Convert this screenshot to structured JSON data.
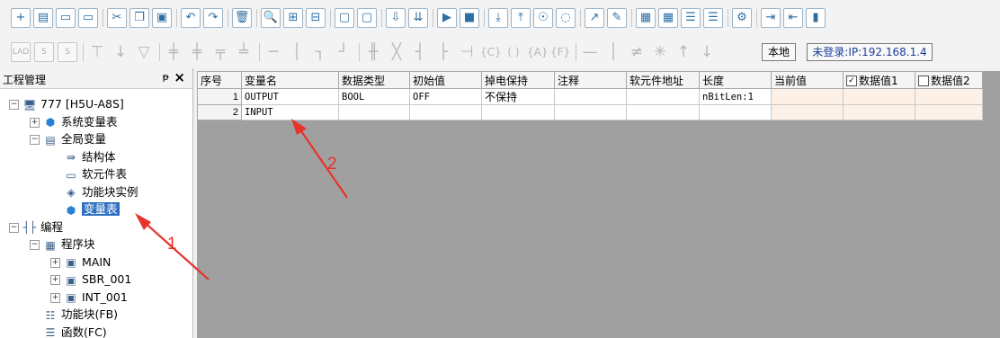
{
  "toolbar_row1": [
    {
      "name": "new-file",
      "glyph": "+"
    },
    {
      "name": "open-folder",
      "glyph": "▤"
    },
    {
      "name": "save",
      "glyph": "▭"
    },
    {
      "name": "save-all",
      "glyph": "▭"
    },
    {
      "name": "cut",
      "glyph": "✂"
    },
    {
      "name": "copy",
      "glyph": "❐"
    },
    {
      "name": "paste",
      "glyph": "▣"
    },
    {
      "name": "undo",
      "glyph": "↶"
    },
    {
      "name": "redo",
      "glyph": "↷"
    },
    {
      "name": "delete",
      "glyph": "🗑"
    },
    {
      "name": "find",
      "glyph": "🔍"
    },
    {
      "name": "network",
      "glyph": "⊞"
    },
    {
      "name": "device",
      "glyph": "⊟"
    },
    {
      "name": "window-1",
      "glyph": "▢"
    },
    {
      "name": "window-2",
      "glyph": "▢"
    },
    {
      "name": "compile",
      "glyph": "⇩"
    },
    {
      "name": "compile-all",
      "glyph": "⇊"
    },
    {
      "name": "run",
      "glyph": "▶"
    },
    {
      "name": "stop",
      "glyph": "■"
    },
    {
      "name": "download",
      "glyph": "⤓"
    },
    {
      "name": "upload",
      "glyph": "⤒"
    },
    {
      "name": "monitor",
      "glyph": "☉"
    },
    {
      "name": "monitor-off",
      "glyph": "◌"
    },
    {
      "name": "edit",
      "glyph": "↗"
    },
    {
      "name": "write",
      "glyph": "✎"
    },
    {
      "name": "config-a",
      "glyph": "▦"
    },
    {
      "name": "config-b",
      "glyph": "▦"
    },
    {
      "name": "align-a",
      "glyph": "☰"
    },
    {
      "name": "align-b",
      "glyph": "☰"
    },
    {
      "name": "test",
      "glyph": "⚙"
    },
    {
      "name": "login",
      "glyph": "⇥"
    },
    {
      "name": "logout",
      "glyph": "⇤"
    },
    {
      "name": "book",
      "glyph": "▮"
    }
  ],
  "toolbar_row2": {
    "ladder_icons": [
      {
        "name": "lad",
        "glyph": "LAD"
      },
      {
        "name": "stl",
        "glyph": "S"
      },
      {
        "name": "sfc",
        "glyph": "S"
      },
      {
        "name": "contact-no",
        "glyph": "⊤"
      },
      {
        "name": "contact-nc",
        "glyph": "↓"
      },
      {
        "name": "coil",
        "glyph": "▽"
      },
      {
        "name": "hline-a",
        "glyph": "╪"
      },
      {
        "name": "hline-b",
        "glyph": "╪"
      },
      {
        "name": "hline-c",
        "glyph": "╤"
      },
      {
        "name": "hline-d",
        "glyph": "╧"
      },
      {
        "name": "wire-h",
        "glyph": "─"
      },
      {
        "name": "wire-v",
        "glyph": "│"
      },
      {
        "name": "wire-l",
        "glyph": "┐"
      },
      {
        "name": "wire-r",
        "glyph": "┘"
      },
      {
        "name": "contact-p",
        "glyph": "╫"
      },
      {
        "name": "contact-n",
        "glyph": "╳"
      },
      {
        "name": "rise",
        "glyph": "┤"
      },
      {
        "name": "fall",
        "glyph": "├"
      },
      {
        "name": "pulse",
        "glyph": "⊣"
      },
      {
        "name": "out-c",
        "glyph": "{C}"
      },
      {
        "name": "paren",
        "glyph": "( )"
      },
      {
        "name": "out-a",
        "glyph": "{A}"
      },
      {
        "name": "out-f",
        "glyph": "{F}"
      },
      {
        "name": "line",
        "glyph": "—"
      },
      {
        "name": "vline",
        "glyph": "│"
      },
      {
        "name": "not",
        "glyph": "≠"
      },
      {
        "name": "cross",
        "glyph": "✳"
      },
      {
        "name": "up",
        "glyph": "↑"
      },
      {
        "name": "down",
        "glyph": "↓"
      }
    ],
    "local_label": "本地",
    "login_status": "未登录:IP:192.168.1.4"
  },
  "tree": {
    "title": "工程管理",
    "pin": "ᵽ",
    "close": "×",
    "nodes": [
      {
        "label": "777 [H5U-A8S]",
        "icon": "computer-icon",
        "glyph": "🖥",
        "depth": 0,
        "exp": "−"
      },
      {
        "label": "系统变量表",
        "icon": "variable-table-icon",
        "glyph": "⬢",
        "depth": 1,
        "exp": "+"
      },
      {
        "label": "全局变量",
        "icon": "document-icon",
        "glyph": "▤",
        "depth": 1,
        "exp": "−"
      },
      {
        "label": "结构体",
        "icon": "struct-icon",
        "glyph": "⇛",
        "depth": 2,
        "exp": ""
      },
      {
        "label": "软元件表",
        "icon": "comment-icon",
        "glyph": "▭",
        "depth": 2,
        "exp": ""
      },
      {
        "label": "功能块实例",
        "icon": "cube-icon",
        "glyph": "◈",
        "depth": 2,
        "exp": ""
      },
      {
        "label": "变量表",
        "icon": "variable-table-icon",
        "glyph": "⬢",
        "depth": 2,
        "exp": "",
        "selected": true
      },
      {
        "label": "编程",
        "icon": "ladder-icon",
        "glyph": "┤├",
        "depth": 0,
        "exp": "−"
      },
      {
        "label": "程序块",
        "icon": "blocks-icon",
        "glyph": "▦",
        "depth": 1,
        "exp": "−"
      },
      {
        "label": "MAIN",
        "icon": "main-program-icon",
        "glyph": "▣",
        "depth": 2,
        "exp": "+"
      },
      {
        "label": "SBR_001",
        "icon": "subroutine-icon",
        "glyph": "▣",
        "depth": 2,
        "exp": "+"
      },
      {
        "label": "INT_001",
        "icon": "interrupt-icon",
        "glyph": "▣",
        "depth": 2,
        "exp": "+"
      },
      {
        "label": "功能块(FB)",
        "icon": "function-block-icon",
        "glyph": "☷",
        "depth": 1,
        "exp": ""
      },
      {
        "label": "函数(FC)",
        "icon": "function-icon",
        "glyph": "☰",
        "depth": 1,
        "exp": ""
      }
    ]
  },
  "grid": {
    "columns": [
      "序号",
      "变量名",
      "数据类型",
      "初始值",
      "掉电保持",
      "注释",
      "软元件地址",
      "长度",
      "当前值",
      "数据值1",
      "数据值2"
    ],
    "checkbox_columns": [
      {
        "index": 9,
        "checked": true
      },
      {
        "index": 10,
        "checked": false
      }
    ],
    "rows": [
      [
        "1",
        "OUTPUT",
        "BOOL",
        "OFF",
        "不保持",
        "",
        "",
        "nBitLen:1",
        "",
        "",
        ""
      ],
      [
        "2",
        "INPUT",
        "",
        "",
        "",
        "",
        "",
        "",
        "",
        "",
        ""
      ]
    ]
  },
  "annotations": [
    {
      "label": "1",
      "color": "#e8332a"
    },
    {
      "label": "2",
      "color": "#e8332a"
    }
  ]
}
